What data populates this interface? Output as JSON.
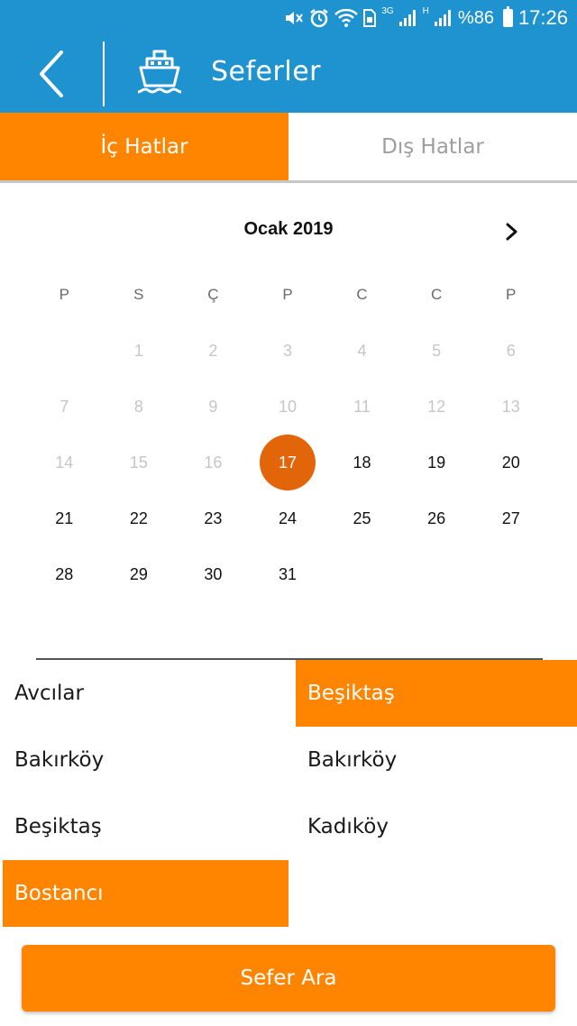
{
  "status_bar": {
    "network_3g": "3G",
    "network_h": "H",
    "battery": "%86",
    "time": "17:26"
  },
  "app_bar": {
    "title": "Seferler",
    "back_icon": "chevron-left-icon",
    "ship_icon": "ship-icon",
    "color": "#1e93d0"
  },
  "tabs": [
    {
      "label": "İç Hatlar",
      "active": true
    },
    {
      "label": "Dış Hatlar",
      "active": false
    }
  ],
  "calendar": {
    "month_label": "Ocak 2019",
    "next_icon": "chevron-right-icon",
    "weekdays": [
      "P",
      "S",
      "Ç",
      "P",
      "C",
      "C",
      "P"
    ],
    "weeks": [
      [
        {
          "d": "",
          "state": "empty"
        },
        {
          "d": "1",
          "state": "disabled"
        },
        {
          "d": "2",
          "state": "disabled"
        },
        {
          "d": "3",
          "state": "disabled"
        },
        {
          "d": "4",
          "state": "disabled"
        },
        {
          "d": "5",
          "state": "disabled"
        },
        {
          "d": "6",
          "state": "disabled"
        }
      ],
      [
        {
          "d": "7",
          "state": "disabled"
        },
        {
          "d": "8",
          "state": "disabled"
        },
        {
          "d": "9",
          "state": "disabled"
        },
        {
          "d": "10",
          "state": "disabled"
        },
        {
          "d": "11",
          "state": "disabled"
        },
        {
          "d": "12",
          "state": "disabled"
        },
        {
          "d": "13",
          "state": "disabled"
        }
      ],
      [
        {
          "d": "14",
          "state": "disabled"
        },
        {
          "d": "15",
          "state": "disabled"
        },
        {
          "d": "16",
          "state": "disabled"
        },
        {
          "d": "17",
          "state": "selected"
        },
        {
          "d": "18",
          "state": "enabled"
        },
        {
          "d": "19",
          "state": "enabled"
        },
        {
          "d": "20",
          "state": "enabled"
        }
      ],
      [
        {
          "d": "21",
          "state": "enabled"
        },
        {
          "d": "22",
          "state": "enabled"
        },
        {
          "d": "23",
          "state": "enabled"
        },
        {
          "d": "24",
          "state": "enabled"
        },
        {
          "d": "25",
          "state": "enabled"
        },
        {
          "d": "26",
          "state": "enabled"
        },
        {
          "d": "27",
          "state": "enabled"
        }
      ],
      [
        {
          "d": "28",
          "state": "enabled"
        },
        {
          "d": "29",
          "state": "enabled"
        },
        {
          "d": "30",
          "state": "enabled"
        },
        {
          "d": "31",
          "state": "enabled"
        },
        {
          "d": "",
          "state": "empty"
        },
        {
          "d": "",
          "state": "empty"
        },
        {
          "d": "",
          "state": "empty"
        }
      ]
    ],
    "selected_color": "#e3650a"
  },
  "departure_ports": [
    {
      "label": "Avcılar",
      "selected": false
    },
    {
      "label": "Bakırköy",
      "selected": false
    },
    {
      "label": "Beşiktaş",
      "selected": false
    },
    {
      "label": "Bostancı",
      "selected": true
    }
  ],
  "arrival_ports": [
    {
      "label": "Beşiktaş",
      "selected": true
    },
    {
      "label": "Bakırköy",
      "selected": false
    },
    {
      "label": "Kadıköy",
      "selected": false
    }
  ],
  "search_button": {
    "label": "Sefer Ara"
  },
  "accent_color": "#ff8400"
}
